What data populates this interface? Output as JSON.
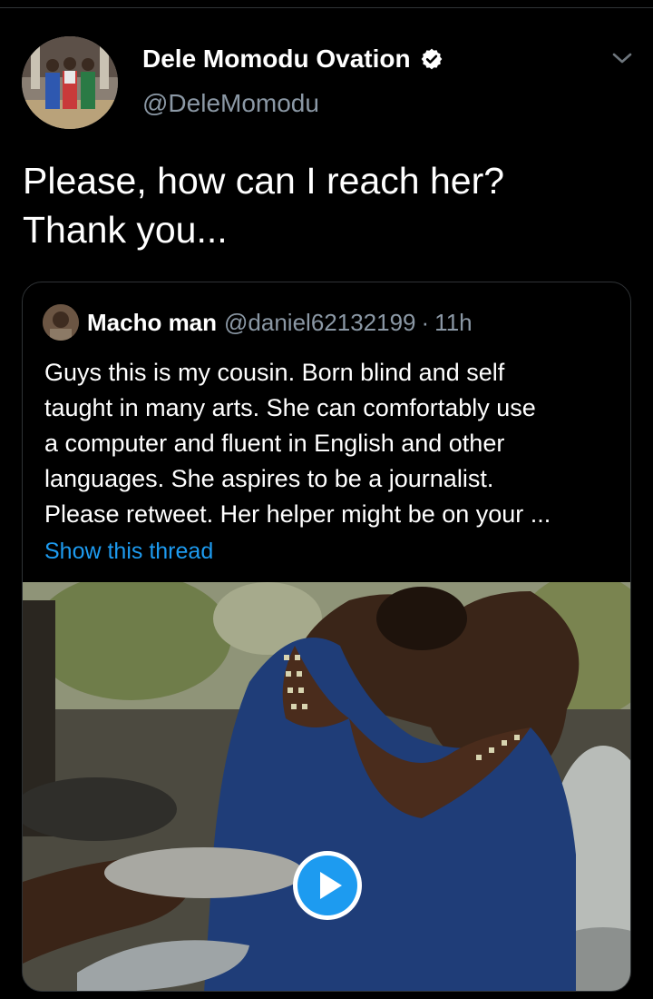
{
  "tweet": {
    "author": {
      "display_name": "Dele Momodu Ovation",
      "handle": "@DeleMomodu",
      "verified": true
    },
    "text_lines": [
      "Please, how can I reach her?",
      "Thank you..."
    ],
    "icons": {
      "verified": "verified-badge-icon",
      "menu": "chevron-down-icon"
    }
  },
  "quoted_tweet": {
    "author": {
      "display_name": "Macho man",
      "handle": "@daniel62132199",
      "separator": "·",
      "time": "11h"
    },
    "text_lines": [
      "Guys this is my cousin. Born blind and self",
      "taught in many arts. She can comfortably use",
      "a computer and fluent in English and other",
      "languages. She aspires to be a journalist.",
      "Please retweet. Her helper might be on your ..."
    ],
    "show_thread_label": "Show this thread",
    "media": {
      "type": "video",
      "play_icon": "play-icon"
    }
  },
  "colors": {
    "background": "#000000",
    "text": "#ffffff",
    "secondary_text": "#8b98a5",
    "link": "#1d9bf0",
    "border": "#2f3336",
    "play_button": "#1d9bf0"
  }
}
